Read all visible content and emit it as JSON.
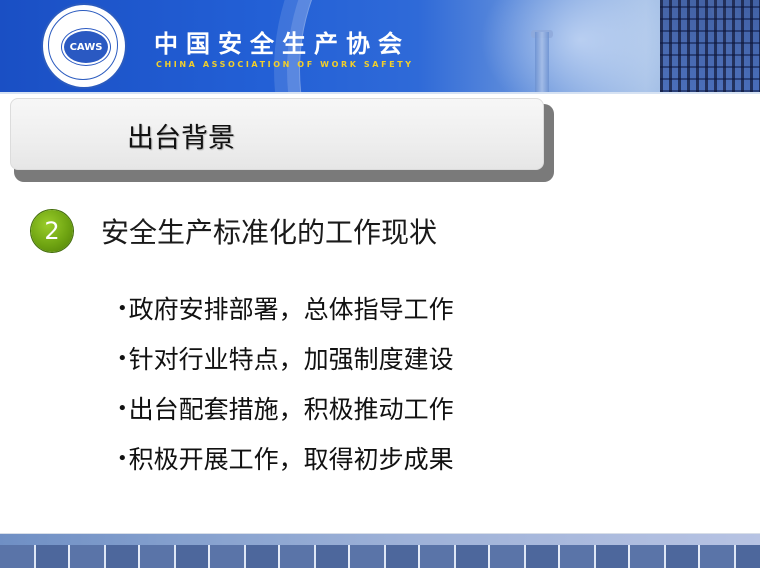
{
  "header": {
    "logo_text": "CAWS",
    "org_name_cn": "中国安全生产协会",
    "org_name_en": "CHINA ASSOCIATION OF WORK SAFETY"
  },
  "slide": {
    "title": "出台背景",
    "section": {
      "number": "2",
      "heading": "安全生产标准化的工作现状",
      "badge_color": "#6fa412"
    },
    "bullet_glyph": "•",
    "bullets": [
      "政府安排部署，总体指导工作",
      "针对行业特点，加强制度建设",
      "出台配套措施，积极推动工作",
      "积极开展工作，取得初步成果"
    ]
  },
  "colors": {
    "header_blue": "#2360d6",
    "english_name_yellow": "#f2cf2a"
  }
}
